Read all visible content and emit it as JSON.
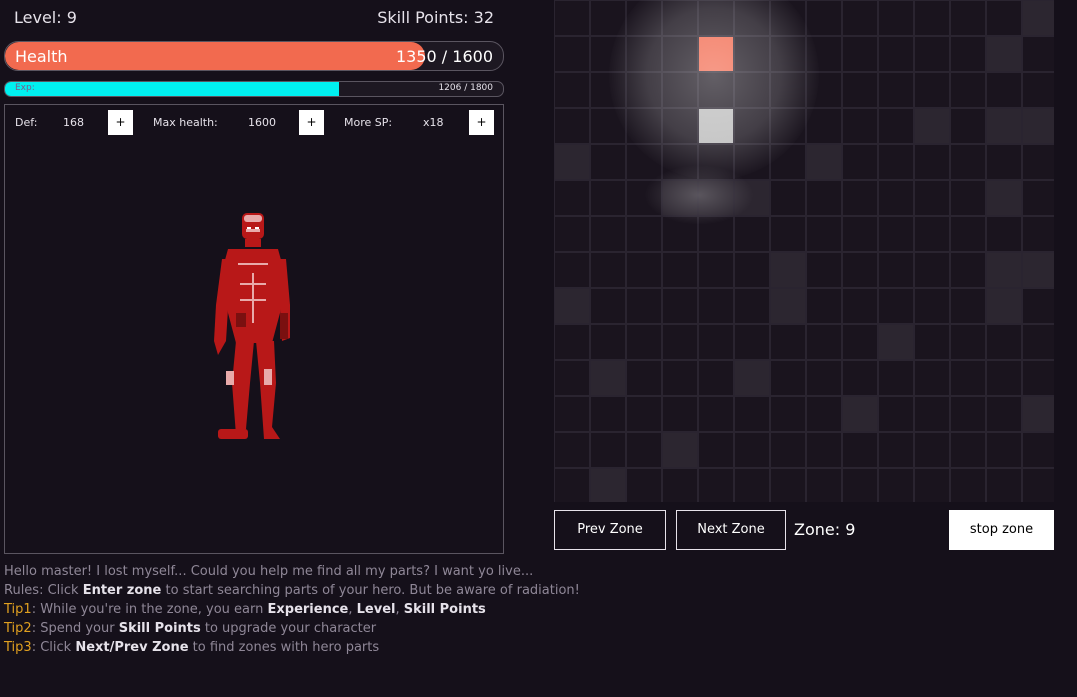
{
  "header": {
    "level": "Level: 9",
    "skill_points": "Skill Points: 32"
  },
  "health": {
    "label": "Health",
    "current": 1350,
    "max": 1600,
    "text": "1350 / 1600",
    "fraction": 0.84375,
    "color": "#f26a4f"
  },
  "exp": {
    "label": "Exp:",
    "current": 1206,
    "max": 1800,
    "text": "1206 / 1800",
    "fraction": 0.67,
    "color": "#00f0f0"
  },
  "stats": {
    "def_label": "Def:",
    "def_value": "168",
    "maxhp_label": "Max health:",
    "maxhp_value": "1600",
    "moresp_label": "More SP:",
    "moresp_value": "x18",
    "plus": "+"
  },
  "grid": {
    "cells": [
      [
        0,
        0,
        0,
        0,
        0,
        0,
        0,
        0,
        0,
        0,
        0,
        0,
        0,
        1
      ],
      [
        0,
        0,
        0,
        0,
        4,
        0,
        0,
        0,
        0,
        0,
        0,
        0,
        1,
        0
      ],
      [
        0,
        0,
        0,
        0,
        0,
        0,
        0,
        0,
        0,
        0,
        0,
        0,
        0,
        0
      ],
      [
        0,
        0,
        0,
        0,
        3,
        0,
        0,
        0,
        0,
        0,
        1,
        0,
        1,
        1
      ],
      [
        1,
        0,
        0,
        0,
        0,
        0,
        0,
        1,
        0,
        0,
        0,
        0,
        0,
        0
      ],
      [
        0,
        0,
        0,
        1,
        1,
        1,
        0,
        0,
        0,
        0,
        0,
        0,
        1,
        0
      ],
      [
        0,
        0,
        0,
        0,
        0,
        0,
        0,
        0,
        0,
        0,
        0,
        0,
        0,
        0
      ],
      [
        0,
        0,
        0,
        0,
        0,
        0,
        1,
        0,
        0,
        0,
        0,
        0,
        1,
        1
      ],
      [
        1,
        0,
        0,
        0,
        0,
        0,
        1,
        0,
        0,
        0,
        0,
        0,
        1,
        0
      ],
      [
        0,
        0,
        0,
        0,
        0,
        0,
        0,
        0,
        0,
        1,
        0,
        0,
        0,
        0
      ],
      [
        0,
        1,
        0,
        0,
        0,
        1,
        0,
        0,
        0,
        0,
        0,
        0,
        0,
        0
      ],
      [
        0,
        0,
        0,
        0,
        0,
        0,
        0,
        0,
        1,
        0,
        0,
        0,
        0,
        1
      ],
      [
        0,
        0,
        0,
        1,
        0,
        0,
        0,
        0,
        0,
        0,
        0,
        0,
        0,
        0
      ],
      [
        0,
        1,
        0,
        0,
        0,
        0,
        0,
        0,
        0,
        0,
        0,
        0,
        0,
        0
      ]
    ],
    "hot_color": "#f26a4f"
  },
  "zone_controls": {
    "prev": "Prev Zone",
    "next": "Next Zone",
    "zone": "Zone: 9",
    "stop": "stop zone"
  },
  "messages": {
    "m1": "Hello master! I lost myself... Could you help me find all my parts? I want yo live...",
    "m2_a": "Rules: Click ",
    "m2_b": "Enter zone",
    "m2_c": " to start searching parts of your hero. But be aware of radiation!",
    "t1_tag": "Tip1",
    "t1_a": ": While you're in the zone, you earn ",
    "t1_b": "Experience",
    "t1_c": ", ",
    "t1_d": "Level",
    "t1_e": ", ",
    "t1_f": "Skill Points",
    "t2_tag": "Tip2",
    "t2_a": ": Spend your ",
    "t2_b": "Skill Points",
    "t2_c": " to upgrade your character",
    "t3_tag": "Tip3",
    "t3_a": ": Click ",
    "t3_b": "Next/Prev Zone",
    "t3_c": " to find zones with hero parts"
  }
}
